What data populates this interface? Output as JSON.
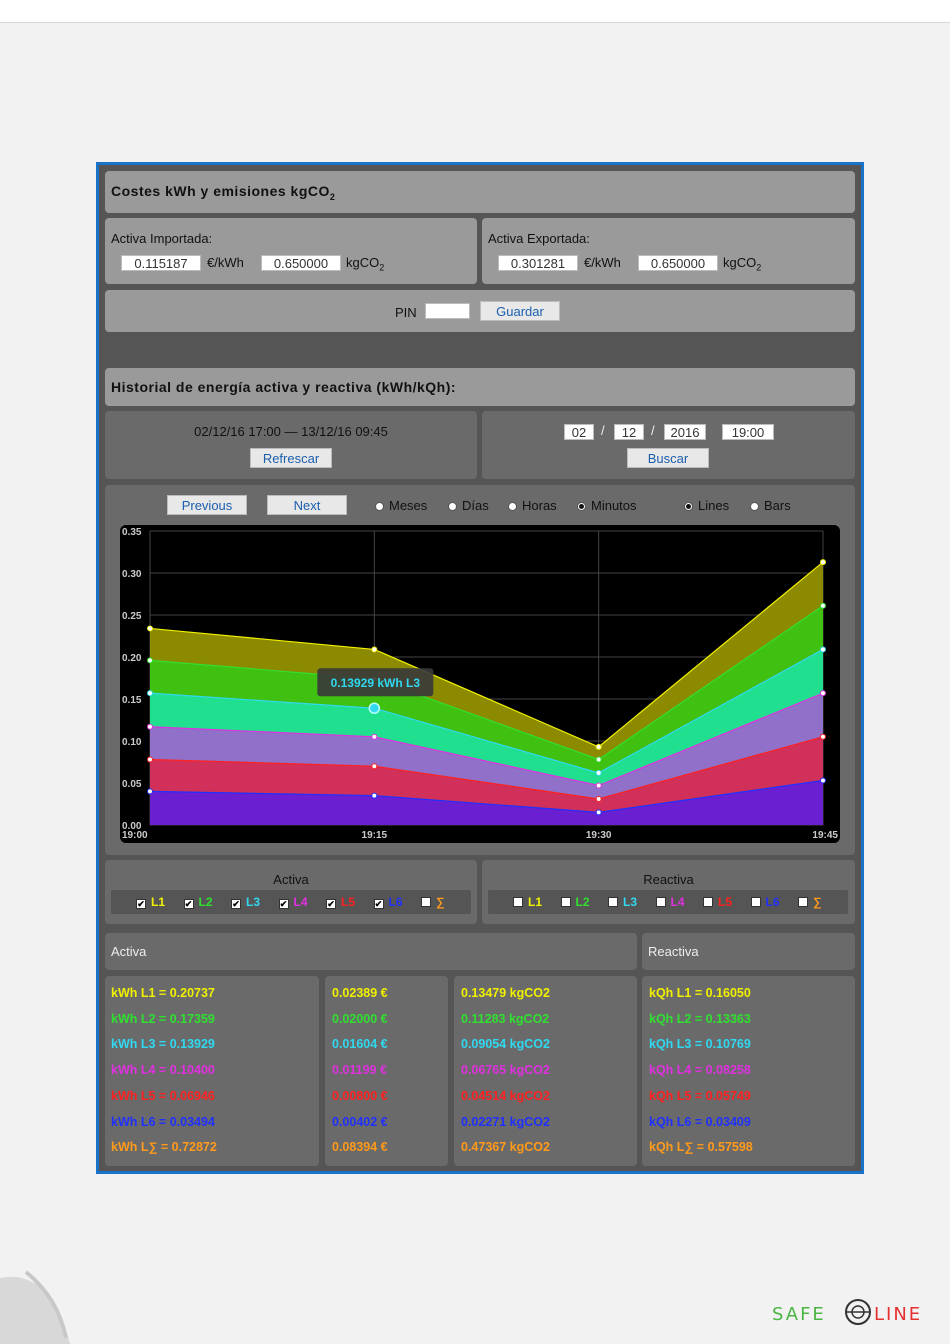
{
  "costes": {
    "title": "Costes kWh y emisiones kgCO",
    "title_sub": "2",
    "importada": {
      "label": "Activa Importada:",
      "price": "0.115187",
      "price_unit": "€/kWh",
      "co2": "0.650000",
      "co2_unit": "kgCO",
      "co2_sub": "2"
    },
    "exportada": {
      "label": "Activa Exportada:",
      "price": "0.301281",
      "price_unit": "€/kWh",
      "co2": "0.650000",
      "co2_unit": "kgCO",
      "co2_sub": "2"
    },
    "pin_label": "PIN",
    "pin_value": "",
    "save_label": "Guardar"
  },
  "historial": {
    "title": "Historial de energía activa y reactiva (kWh/kQh):",
    "range": "02/12/16 17:00 — 13/12/16 09:45",
    "refresh_label": "Refrescar",
    "date": {
      "day": "02",
      "month": "12",
      "year": "2016",
      "time": "19:00",
      "sep": "/"
    },
    "search_label": "Buscar"
  },
  "controls": {
    "previous": "Previous",
    "next": "Next",
    "periods": [
      "Meses",
      "Días",
      "Horas",
      "Minutos"
    ],
    "period_selected": "Minutos",
    "types": [
      "Lines",
      "Bars"
    ],
    "type_selected": "Lines"
  },
  "colors": {
    "L1": "#f0f000",
    "L2": "#30e030",
    "L3": "#30d8f0",
    "L4": "#e030e0",
    "L5": "#ff2020",
    "L6": "#2030ff",
    "sum": "#ff9a1a"
  },
  "chart_data": {
    "type": "area",
    "x": [
      "19:00",
      "19:15",
      "19:30",
      "19:45"
    ],
    "ylim": [
      0,
      0.35
    ],
    "yticks": [
      "0.00",
      "0.05",
      "0.10",
      "0.15",
      "0.20",
      "0.25",
      "0.30",
      "0.35"
    ],
    "stacked": true,
    "series": [
      {
        "name": "L6",
        "color": "#6a1fd0",
        "line": "#2030ff",
        "values": [
          0.04,
          0.035,
          0.015,
          0.053
        ]
      },
      {
        "name": "L5",
        "color": "#d0305a",
        "line": "#ff2020",
        "values": [
          0.078,
          0.07,
          0.031,
          0.105
        ]
      },
      {
        "name": "L4",
        "color": "#9070c8",
        "line": "#e030e0",
        "values": [
          0.117,
          0.105,
          0.047,
          0.157
        ]
      },
      {
        "name": "L3",
        "color": "#20e090",
        "line": "#30d8f0",
        "values": [
          0.157,
          0.139,
          0.062,
          0.209
        ]
      },
      {
        "name": "L2",
        "color": "#40c010",
        "line": "#30e030",
        "values": [
          0.196,
          0.174,
          0.078,
          0.261
        ]
      },
      {
        "name": "L1",
        "color": "#8c8a00",
        "line": "#f0f000",
        "values": [
          0.234,
          0.209,
          0.093,
          0.313
        ]
      }
    ],
    "tooltip": "0.13929 kWh L3",
    "grid": true
  },
  "filters": {
    "activa_label": "Activa",
    "reactiva_label": "Reactiva",
    "activa": [
      {
        "label": "L1",
        "checked": true
      },
      {
        "label": "L2",
        "checked": true
      },
      {
        "label": "L3",
        "checked": true
      },
      {
        "label": "L4",
        "checked": true
      },
      {
        "label": "L5",
        "checked": true
      },
      {
        "label": "L6",
        "checked": true
      },
      {
        "label": "∑",
        "checked": false
      }
    ],
    "reactiva": [
      {
        "label": "L1",
        "checked": false
      },
      {
        "label": "L2",
        "checked": false
      },
      {
        "label": "L3",
        "checked": false
      },
      {
        "label": "L4",
        "checked": false
      },
      {
        "label": "L5",
        "checked": false
      },
      {
        "label": "L6",
        "checked": false
      },
      {
        "label": "∑",
        "checked": false
      }
    ]
  },
  "summary": {
    "activa_header": "Activa",
    "reactiva_header": "Reactiva",
    "kwh": [
      "kWh L1 = 0.20737",
      "kWh L2 = 0.17359",
      "kWh L3 = 0.13929",
      "kWh L4 = 0.10400",
      "kWh L5 = 0.06946",
      "kWh L6 = 0.03494",
      "kWh L∑ = 0.72872"
    ],
    "euro": [
      "0.02389 €",
      "0.02000 €",
      "0.01604 €",
      "0.01199 €",
      "0.00800 €",
      "0.00402 €",
      "0.08394 €"
    ],
    "co2": [
      "0.13479 kgCO2",
      "0.11283 kgCO2",
      "0.09054 kgCO2",
      "0.06765 kgCO2",
      "0.04514 kgCO2",
      "0.02271 kgCO2",
      "0.47367 kgCO2"
    ],
    "kqh": [
      "kQh L1 = 0.16050",
      "kQh L2 = 0.13363",
      "kQh L3 = 0.10769",
      "kQh L4 = 0.08258",
      "kQh L5 = 0.05749",
      "kQh L6 = 0.03409",
      "kQh L∑ = 0.57598"
    ]
  },
  "logo": {
    "text": "SAFE LINE"
  }
}
